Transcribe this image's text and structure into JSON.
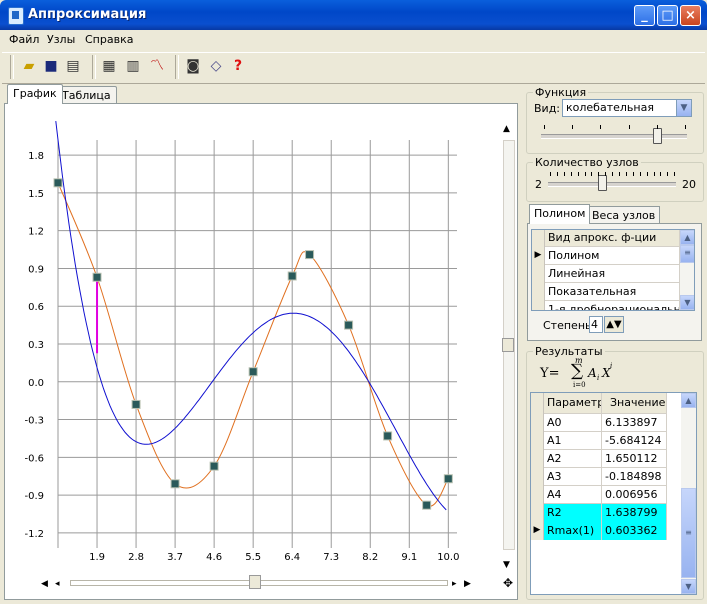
{
  "window": {
    "title": "Аппроксимация"
  },
  "menu": [
    "Файл",
    "Узлы",
    "Справка"
  ],
  "toolbar_icons": [
    "open-folder-icon",
    "save-icon",
    "print-icon",
    "table-icon",
    "grid-icon",
    "chart-icon",
    "projector-icon",
    "eraser-icon",
    "help-icon"
  ],
  "tabs": {
    "graph": "График",
    "table": "Таблица"
  },
  "function_group": {
    "legend": "Функция",
    "type_label": "Вид:",
    "type_value": "колебательная"
  },
  "nodes_group": {
    "legend": "Количество узлов",
    "min": "2",
    "max": "20",
    "value_fraction": 0.42
  },
  "subtabs": {
    "polynom": "Полином",
    "weights": "Веса узлов"
  },
  "approx_grid": {
    "header": "Вид апрокс. ф-ции",
    "rows": [
      "Полином",
      "Линейная",
      "Показательная",
      "1-я дробнорациональная"
    ],
    "selected_index": 0
  },
  "degree": {
    "label": "Степень",
    "value": "4"
  },
  "results": {
    "legend": "Результаты",
    "formula_prefix": "Y=",
    "formula_sum": "∑",
    "formula_upper": "m",
    "formula_lower": "i=0",
    "formula_term": "A",
    "formula_sub": "i",
    "formula_var": "X",
    "formula_sup": "i",
    "headers": [
      "Параметр",
      "Значение"
    ],
    "rows": [
      {
        "param": "A0",
        "value": "6.133897"
      },
      {
        "param": "A1",
        "value": "-5.684124"
      },
      {
        "param": "A2",
        "value": "1.650112"
      },
      {
        "param": "A3",
        "value": "-0.184898"
      },
      {
        "param": "A4",
        "value": "0.006956"
      },
      {
        "param": "R2",
        "value": "1.638799"
      },
      {
        "param": "Rmax(1)",
        "value": "0.603362"
      }
    ],
    "highlight_color": "#00ffff"
  },
  "chart_data": {
    "type": "line",
    "x_ticks": [
      "1.9",
      "2.8",
      "3.7",
      "4.6",
      "5.5",
      "6.4",
      "7.3",
      "8.2",
      "9.1",
      "10.0"
    ],
    "y_ticks": [
      "1.8",
      "1.5",
      "1.2",
      "0.9",
      "0.6",
      "0.3",
      "0.0",
      "-0.3",
      "-0.6",
      "-0.9",
      "-1.2"
    ],
    "xlim": [
      1.0,
      10.2
    ],
    "ylim": [
      -1.32,
      1.92
    ],
    "grid": true,
    "nodes": {
      "x": [
        1.0,
        1.9,
        2.8,
        3.7,
        4.6,
        5.5,
        6.4,
        7.3,
        8.2,
        9.1,
        10.0
      ],
      "y": [
        1.58,
        0.83,
        -0.18,
        -0.81,
        -0.67,
        0.08,
        0.84,
        1.01,
        0.45,
        -0.43,
        -0.98,
        -0.77
      ]
    },
    "node_points": [
      [
        1.0,
        1.58
      ],
      [
        1.9,
        0.83
      ],
      [
        2.8,
        -0.18
      ],
      [
        3.7,
        -0.81
      ],
      [
        4.6,
        -0.67
      ],
      [
        5.5,
        0.08
      ],
      [
        6.4,
        0.84
      ],
      [
        6.8,
        1.01
      ],
      [
        7.7,
        0.45
      ],
      [
        8.6,
        -0.43
      ],
      [
        9.5,
        -0.98
      ],
      [
        10.0,
        -0.77
      ]
    ],
    "series": [
      {
        "color": "#1010d0",
        "coeffs": [
          6.133897,
          -5.684124,
          1.650112,
          -0.184898,
          0.006956
        ]
      },
      {
        "color": "#e07020"
      }
    ],
    "rmax_marker": {
      "x": 1.9,
      "y_from": 0.83,
      "y_to": 0.227,
      "color": "#e000e0"
    }
  }
}
